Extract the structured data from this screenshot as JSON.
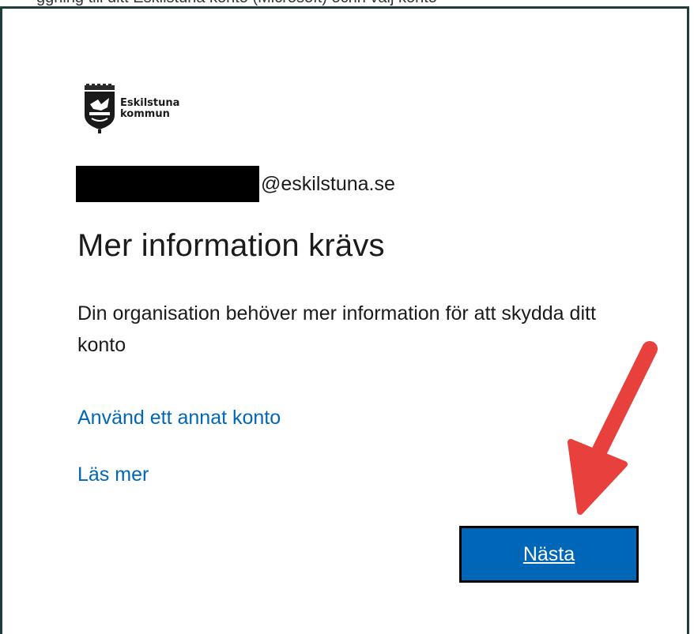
{
  "top_strip": {
    "text": "ggning till ditt Eskilstuna konto (Microsoft) ochh välj konto"
  },
  "logo": {
    "line1": "Eskilstuna",
    "line2": "kommun"
  },
  "identity": {
    "domain": "@eskilstuna.se"
  },
  "title": "Mer information krävs",
  "description": "Din organisation behöver mer information för att skydda ditt konto",
  "links": {
    "other_account": "Använd ett annat konto",
    "learn_more": "Läs mer"
  },
  "buttons": {
    "next": "Nästa"
  },
  "colors": {
    "link": "#0067b8",
    "button_bg": "#0067b8",
    "arrow": "#e8403c",
    "frame": "#1e3c3a"
  }
}
